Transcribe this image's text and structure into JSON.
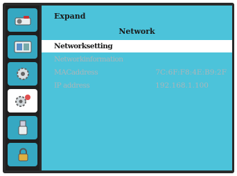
{
  "panel": {
    "title": "Expand",
    "subtitle": "Network"
  },
  "menu": [
    {
      "label": "Networksetting",
      "value": "",
      "state": "selected"
    },
    {
      "label": "Networkinformation",
      "value": "",
      "state": "dim"
    },
    {
      "label": "MACaddress",
      "value": "7C:6F:F8:4E:B9:2F",
      "state": "dim"
    },
    {
      "label": "IP address",
      "value": "192.168.1.100",
      "state": "dim"
    }
  ],
  "sidebar": {
    "items": [
      {
        "icon": "projector-icon"
      },
      {
        "icon": "picture-icon"
      },
      {
        "icon": "settings-gear-icon"
      },
      {
        "icon": "expand-gears-icon",
        "active": true
      },
      {
        "icon": "usb-icon"
      },
      {
        "icon": "lock-icon"
      }
    ]
  },
  "colors": {
    "panel_bg": "#4cc3da",
    "sidebar_item_bg": "#36a8c2",
    "selected_row_bg": "#ffffff",
    "dim_text": "#a9b6bb"
  }
}
